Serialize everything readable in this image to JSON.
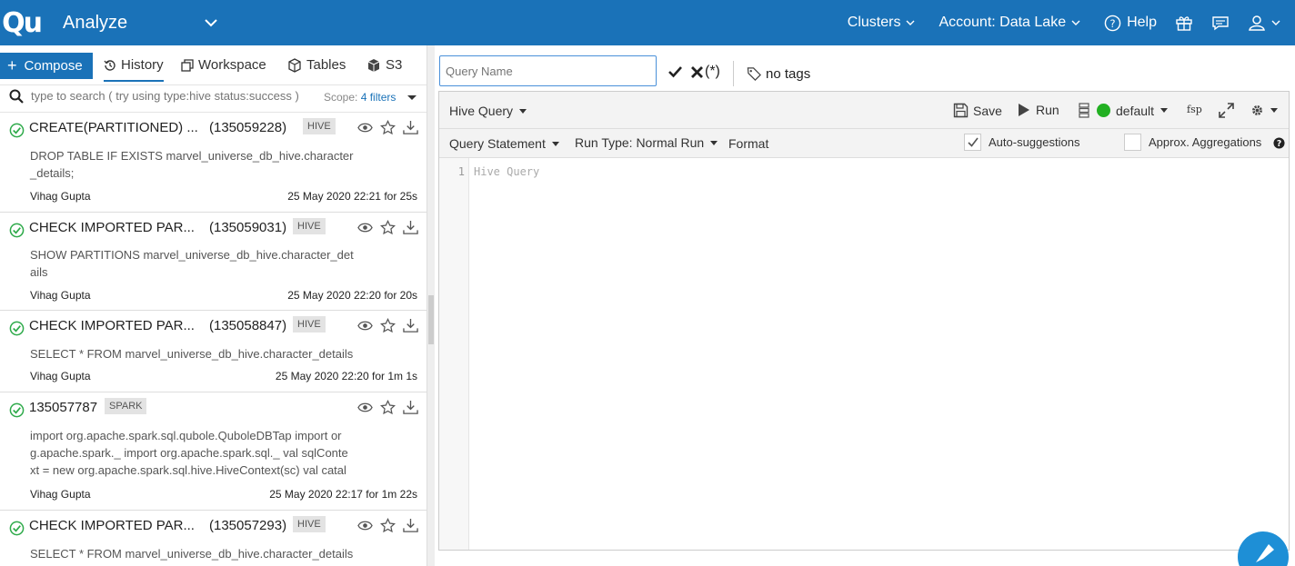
{
  "header": {
    "logo_text": "Qu",
    "app_title": "Analyze",
    "clusters_label": "Clusters",
    "account_label": "Account: Data Lake",
    "help_label": "Help"
  },
  "left": {
    "compose_label": "Compose",
    "tabs": [
      "History",
      "Workspace",
      "Tables",
      "S3"
    ],
    "search_placeholder": "type to search ( try using type:hive status:success )",
    "scope_label": "Scope:",
    "scope_filters": "4 filters",
    "history": [
      {
        "title": "CREATE(PARTITIONED) ...",
        "id": "(135059228)",
        "badge": "HIVE",
        "query": "DROP TABLE IF EXISTS marvel_universe_db_hive.character _details;",
        "user": "Vihag Gupta",
        "time": "25 May 2020 22:21 for 25s"
      },
      {
        "title": "CHECK IMPORTED PAR...",
        "id": "(135059031)",
        "badge": "HIVE",
        "query": "SHOW PARTITIONS marvel_universe_db_hive.character_det ails",
        "user": "Vihag Gupta",
        "time": "25 May 2020 22:20 for 20s"
      },
      {
        "title": "CHECK IMPORTED PAR...",
        "id": "(135058847)",
        "badge": "HIVE",
        "query": "SELECT * FROM marvel_universe_db_hive.character_details",
        "user": "Vihag Gupta",
        "time": "25 May 2020 22:20 for 1m 1s"
      },
      {
        "title": "135057787",
        "id": "",
        "badge": "SPARK",
        "query": "import org.apache.spark.sql.qubole.QuboleDBTap import or g.apache.spark._ import org.apache.spark.sql._ val sqlConte xt = new org.apache.spark.sql.hive.HiveContext(sc) val catal",
        "user": "Vihag Gupta",
        "time": "25 May 2020 22:17 for 1m 22s"
      },
      {
        "title": "CHECK IMPORTED PAR...",
        "id": "(135057293)",
        "badge": "HIVE",
        "query": "SELECT * FROM marvel_universe_db_hive.character_details",
        "user": "",
        "time": ""
      }
    ]
  },
  "right": {
    "query_name_placeholder": "Query Name",
    "cancel_suffix": "(*)",
    "tags_label": "no tags",
    "query_type": "Hive Query",
    "save_label": "Save",
    "run_label": "Run",
    "cluster_label": "default",
    "fsp_label": "fsp",
    "statement_label": "Query Statement",
    "run_type_label": "Run Type: Normal Run",
    "format_label": "Format",
    "auto_suggest_label": "Auto-suggestions",
    "approx_label": "Approx. Aggregations",
    "line_number": "1",
    "editor_placeholder": "Hive Query"
  },
  "colors": {
    "brand": "#1a72b8",
    "success": "#2eaa4a",
    "cluster_status": "#22b022"
  }
}
